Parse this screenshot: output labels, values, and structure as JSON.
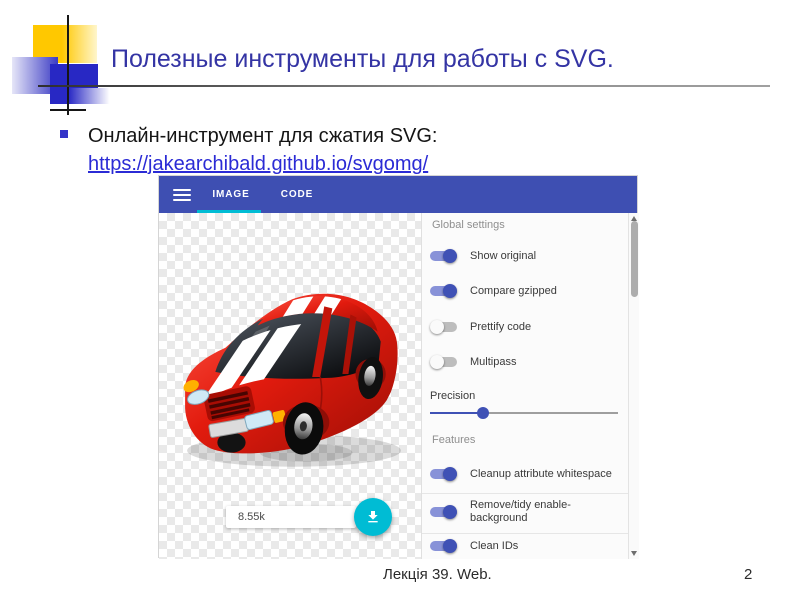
{
  "colors": {
    "title-blue": "#3434A4",
    "link-blue": "#2B2BD5",
    "toolbar-indigo": "#3E4FB2",
    "accent-teal": "#00BCD4",
    "toggle-on-track": "#8892D8",
    "toggle-on-thumb": "#3F51B5",
    "toggle-off-track": "#BDBDBD",
    "toggle-off-thumb": "#FAFAFA",
    "panel-label-gray": "#8F8F8F",
    "car-red": "#D8130B",
    "deco-yellow": "#FFC800",
    "deco-blue": "#2828C4"
  },
  "slide": {
    "title": "Полезные инструменты для работы с SVG.",
    "bullet_text": "Онлайн-инструмент для сжатия SVG:",
    "bullet_link": "https://jakearchibald.github.io/svgomg/",
    "footer_text": "Лекція 39. Web.",
    "page_number": "2"
  },
  "svgomg": {
    "toolbar": {
      "tabs": [
        {
          "label": "IMAGE",
          "active": true
        },
        {
          "label": "CODE",
          "active": false
        }
      ]
    },
    "canvas": {
      "image_description": "Red toy car with white racing stripes on transparent checkerboard",
      "size_badge": "8.55k"
    },
    "settings": {
      "global_label": "Global settings",
      "global_toggles": [
        {
          "label": "Show original",
          "on": true
        },
        {
          "label": "Compare gzipped",
          "on": true
        },
        {
          "label": "Prettify code",
          "on": false
        },
        {
          "label": "Multipass",
          "on": false
        }
      ],
      "precision_label": "Precision",
      "precision_percent": 28,
      "features_label": "Features",
      "feature_toggles": [
        {
          "label": "Cleanup attribute whitespace",
          "on": true
        },
        {
          "label": "Remove/tidy enable-background",
          "on": true
        },
        {
          "label": "Clean IDs",
          "on": true
        }
      ]
    }
  }
}
